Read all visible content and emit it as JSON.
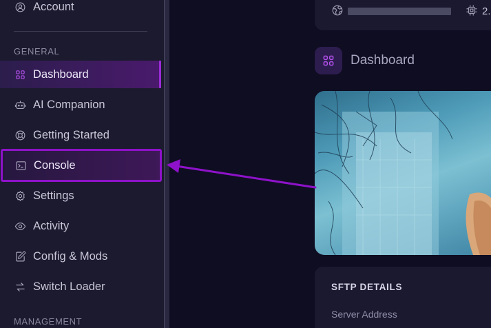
{
  "sidebar": {
    "account_label": "Account",
    "general_title": "GENERAL",
    "management_title": "MANAGEMENT",
    "items": [
      {
        "label": "Dashboard",
        "icon": "grid-icon"
      },
      {
        "label": "AI Companion",
        "icon": "robot-icon"
      },
      {
        "label": "Getting Started",
        "icon": "lifebuoy-icon"
      },
      {
        "label": "Console",
        "icon": "terminal-icon"
      },
      {
        "label": "Settings",
        "icon": "gear-icon"
      },
      {
        "label": "Activity",
        "icon": "eye-icon"
      },
      {
        "label": "Config & Mods",
        "icon": "edit-file-icon"
      },
      {
        "label": "Switch Loader",
        "icon": "swap-arrows-icon"
      }
    ]
  },
  "top_card": {
    "cpu_text": "2."
  },
  "main": {
    "title": "Dashboard"
  },
  "sftp": {
    "title": "SFTP DETAILS",
    "server_address_label": "Server Address"
  },
  "colors": {
    "accent": "#9b2bd6",
    "highlight_border": "#8e12c9",
    "sidebar_bg": "#1c1a2e",
    "page_bg": "#0f0d22"
  }
}
